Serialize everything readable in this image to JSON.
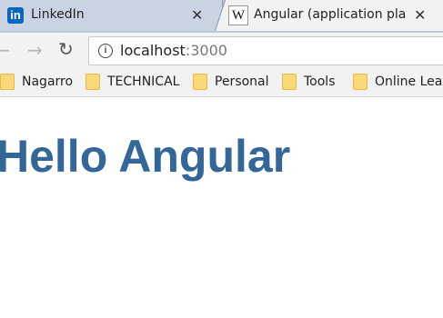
{
  "tabs": [
    {
      "label": "LinkedIn",
      "favicon": "linkedin-icon",
      "favicon_text": "in",
      "active": false
    },
    {
      "label": "Angular (application plat",
      "favicon": "wikipedia-icon",
      "favicon_text": "W",
      "active": true
    }
  ],
  "toolbar": {
    "back_icon": "←",
    "forward_icon": "→",
    "reload_icon": "↻",
    "info_icon": "i",
    "url_host": "localhost",
    "url_port": ":3000"
  },
  "bookmarks": [
    {
      "label": "Nagarro"
    },
    {
      "label": "TECHNICAL"
    },
    {
      "label": "Personal"
    },
    {
      "label": "Tools"
    },
    {
      "label": "Online Lear"
    }
  ],
  "page": {
    "heading": "Hello Angular",
    "heading_color": "#336699"
  },
  "colors": {
    "tabstrip": "#bfc9d8",
    "toolbar": "#f2f2f2"
  }
}
